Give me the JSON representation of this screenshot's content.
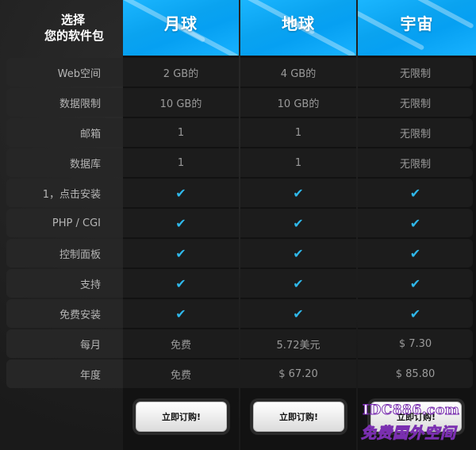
{
  "header": {
    "choose_line1": "选择",
    "choose_line2": "您的软件包"
  },
  "plans": [
    {
      "name": "月球",
      "order_label": "立即订购!"
    },
    {
      "name": "地球",
      "order_label": "立即订购!"
    },
    {
      "name": "宇宙",
      "order_label": "立即订购!"
    }
  ],
  "rows": [
    {
      "label": "Web空间",
      "values": [
        "2 GB的",
        "4 GB的",
        "无限制"
      ]
    },
    {
      "label": "数据限制",
      "values": [
        "10 GB的",
        "10 GB的",
        "无限制"
      ]
    },
    {
      "label": "邮箱",
      "values": [
        "1",
        "1",
        "无限制"
      ]
    },
    {
      "label": "数据库",
      "values": [
        "1",
        "1",
        "无限制"
      ]
    },
    {
      "label": "1，点击安装",
      "values": [
        "✔",
        "✔",
        "✔"
      ]
    },
    {
      "label": "PHP / CGI",
      "values": [
        "✔",
        "✔",
        "✔"
      ]
    },
    {
      "label": "控制面板",
      "values": [
        "✔",
        "✔",
        "✔"
      ]
    },
    {
      "label": "支持",
      "values": [
        "✔",
        "✔",
        "✔"
      ]
    },
    {
      "label": "免费安装",
      "values": [
        "✔",
        "✔",
        "✔"
      ]
    },
    {
      "label": "每月",
      "values": [
        "免费",
        "5.72美元",
        "$ 7.30"
      ]
    },
    {
      "label": "年度",
      "values": [
        "免费",
        "$ 67.20",
        "$ 85.80"
      ]
    }
  ],
  "watermark": {
    "line1": "IDC886.com",
    "line2": "免费国外空间"
  },
  "colors": {
    "accent": "#0aa3f0",
    "check": "#2fb8ea",
    "background": "#1e1e1e"
  }
}
